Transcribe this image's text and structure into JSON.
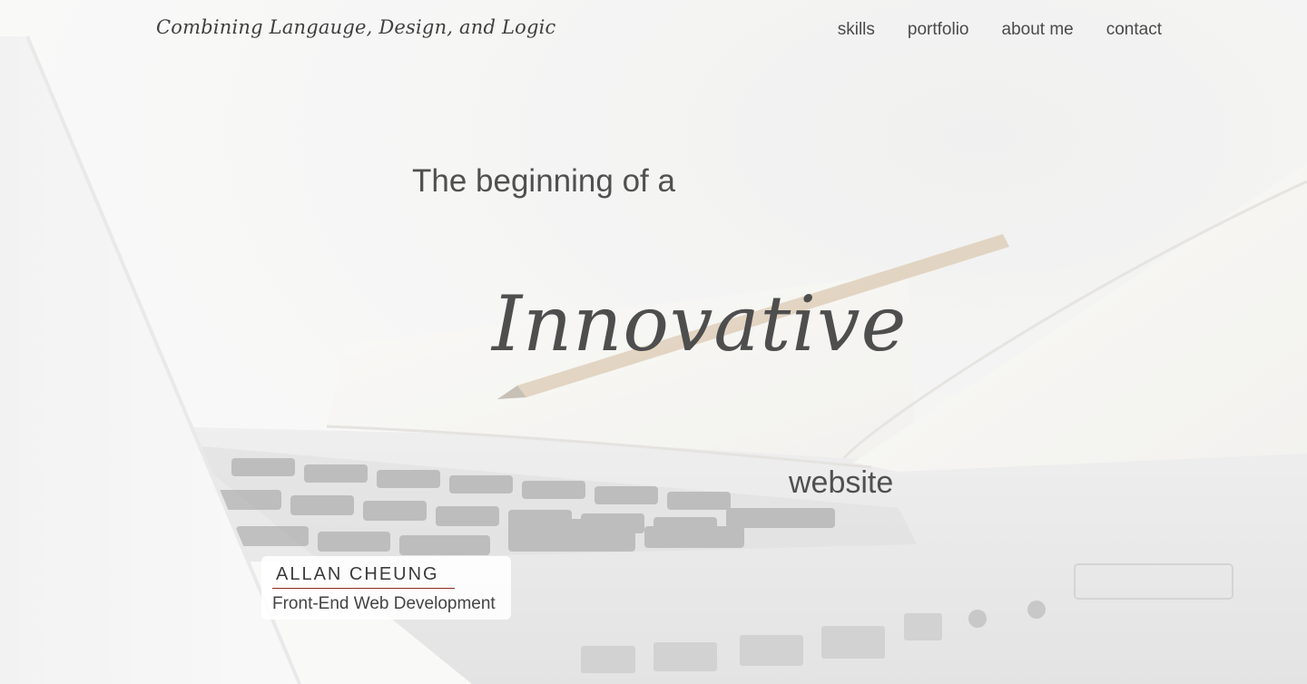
{
  "header": {
    "logo_text": "Combining Langauge, Design, and Logic",
    "nav": [
      {
        "label": "skills"
      },
      {
        "label": "portfolio"
      },
      {
        "label": "about me"
      },
      {
        "label": "contact"
      }
    ]
  },
  "hero": {
    "line1": "The beginning of a",
    "highlight_word": "Innovative",
    "line3": "website"
  },
  "profile_card": {
    "name": "ALLAN CHEUNG",
    "role": "Front-End Web Development",
    "accent_color": "#8b2a22"
  },
  "background": {
    "image_subject": "laptop keyboard with open notebook and pencil"
  }
}
